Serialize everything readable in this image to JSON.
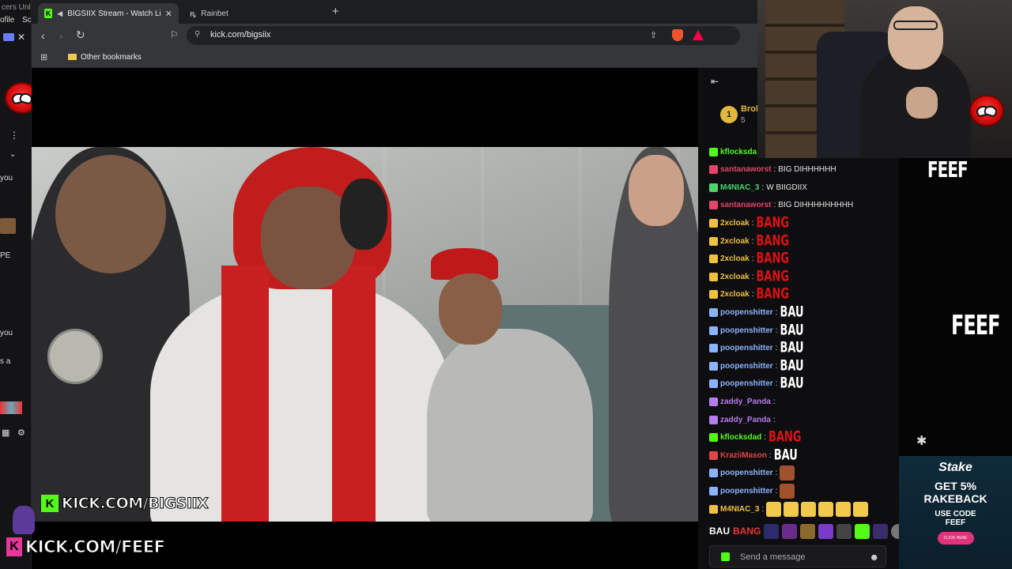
{
  "browser": {
    "tabs": [
      {
        "label": "BIGSIIX Stream - Watch Live o",
        "active": true
      },
      {
        "label": "Rainbet",
        "active": false
      }
    ],
    "url": "kick.com/bigsiix",
    "bookmarks": [
      {
        "label": "Other bookmarks"
      }
    ]
  },
  "left_strip": {
    "texts": [
      "cers Unl",
      "ofile",
      "Sc",
      "you",
      "PE",
      "you",
      "s a"
    ]
  },
  "streamer_box": {
    "name": "Brok",
    "count": "5",
    "rank": "1"
  },
  "chat": {
    "messages": [
      {
        "user": "kflocksda",
        "text": "",
        "color": "#53fc18"
      },
      {
        "user": "santanaworst",
        "text": "BIG DIHHHHHH",
        "color": "#e2456b"
      },
      {
        "user": "M4NIAC_3",
        "text": "W BIIGDIIX",
        "color": "#4ad66d"
      },
      {
        "user": "santanaworst",
        "text": "BIG DIHHHHHHHHH",
        "color": "#e2456b"
      },
      {
        "user": "2xcloak",
        "text": "",
        "color": "#f0c040",
        "emote": "BANG"
      },
      {
        "user": "2xcloak",
        "text": "",
        "color": "#f0c040",
        "emote": "BANG"
      },
      {
        "user": "2xcloak",
        "text": "",
        "color": "#f0c040",
        "emote": "BANG"
      },
      {
        "user": "2xcloak",
        "text": "",
        "color": "#f0c040",
        "emote": "BANG"
      },
      {
        "user": "2xcloak",
        "text": "",
        "color": "#f0c040",
        "emote": "BANG"
      },
      {
        "user": "poopenshitter",
        "text": "",
        "color": "#8bb4ff",
        "emote": "BAU"
      },
      {
        "user": "poopenshitter",
        "text": "",
        "color": "#8bb4ff",
        "emote": "BAU"
      },
      {
        "user": "poopenshitter",
        "text": "",
        "color": "#8bb4ff",
        "emote": "BAU"
      },
      {
        "user": "poopenshitter",
        "text": "",
        "color": "#8bb4ff",
        "emote": "BAU"
      },
      {
        "user": "poopenshitter",
        "text": "",
        "color": "#8bb4ff",
        "emote": "BAU"
      },
      {
        "user": "zaddy_Panda",
        "text": "",
        "color": "#b57cf0"
      },
      {
        "user": "zaddy_Panda",
        "text": "",
        "color": "#b57cf0"
      },
      {
        "user": "kflocksdad",
        "text": "",
        "color": "#53fc18",
        "emote": "BANG"
      },
      {
        "user": "KraziiMason",
        "text": "",
        "color": "#e24545",
        "emote": "BAU"
      },
      {
        "user": "poopenshitter",
        "text": "",
        "color": "#8bb4ff",
        "emote": "face"
      },
      {
        "user": "poopenshitter",
        "text": "",
        "color": "#8bb4ff",
        "emote": "face"
      },
      {
        "user": "M4NIAC_3",
        "text": "",
        "color": "#f0c040",
        "emote": "laugh"
      }
    ],
    "input_placeholder": "Send a message",
    "emote_bar": [
      "BAU",
      "BANG"
    ]
  },
  "overlay": {
    "kick_video": "KICK.COM/BIGSIIX",
    "kick_bottom": "KICK.COM/FEEF",
    "feef_top": "FEEF",
    "feef_mid": "FEEF"
  },
  "ad": {
    "brand": "Stake",
    "line1": "GET 5%",
    "line2": "RAKEBACK",
    "line3": "USE CODE",
    "line4": "FEEF",
    "cta": "CLICK HERE"
  },
  "colors": {
    "kick_green": "#53fc18",
    "chat_bg": "#0e0e10",
    "browser_tab_active": "#35363a"
  }
}
